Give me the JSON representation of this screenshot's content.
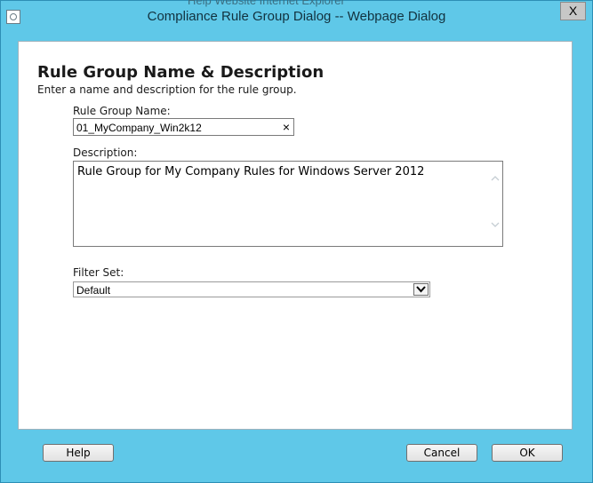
{
  "window": {
    "ghost_text": "Help    Website    Internet Explorer",
    "title": "Compliance Rule Group Dialog -- Webpage Dialog",
    "close_label": "X"
  },
  "form": {
    "heading": "Rule Group Name & Description",
    "subheading": "Enter a name and description for the rule group.",
    "name_label": "Rule Group Name:",
    "name_value": "01_MyCompany_Win2k12",
    "name_clear": "×",
    "description_label": "Description:",
    "description_value": "Rule Group for My Company Rules for Windows Server 2012",
    "filter_label": "Filter Set:",
    "filter_value": "Default"
  },
  "buttons": {
    "help": "Help",
    "cancel": "Cancel",
    "ok": "OK"
  },
  "icons": {
    "app": "document-icon",
    "close": "close-icon",
    "clear": "clear-icon",
    "scroll_up": "chevron-up-icon",
    "scroll_down": "chevron-down-icon",
    "dropdown": "chevron-down-icon"
  },
  "colors": {
    "frame": "#5fc8e8",
    "content_bg": "#ffffff"
  }
}
